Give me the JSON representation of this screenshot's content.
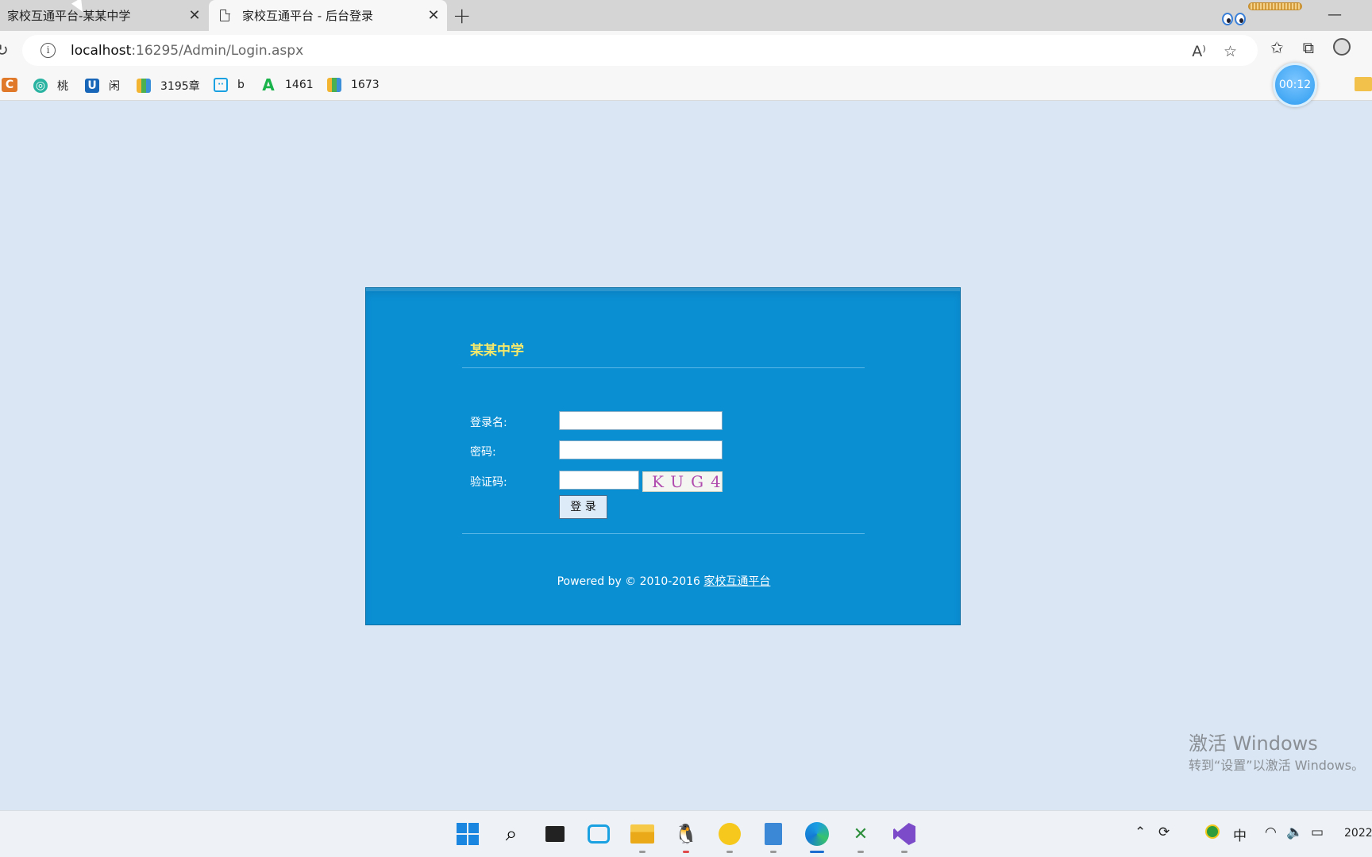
{
  "tabs": [
    {
      "title": "家校互通平台-某某中学",
      "active": false
    },
    {
      "title": "家校互通平台 - 后台登录",
      "active": true
    }
  ],
  "address": {
    "host": "localhost",
    "rest": ":16295/Admin/Login.aspx"
  },
  "bookmarks": [
    {
      "label": "桃",
      "icon": "peach-bookmark-icon"
    },
    {
      "label": "闲",
      "icon": "u-bookmark-icon"
    },
    {
      "label": "3195章",
      "icon": "book-bookmark-icon"
    },
    {
      "label": "b",
      "icon": "bilibili-bookmark-icon"
    },
    {
      "label": "1461",
      "icon": "a-bookmark-icon"
    },
    {
      "label": "1673",
      "icon": "book-bookmark-icon"
    }
  ],
  "timer": "00:12",
  "login": {
    "school_name": "某某中学",
    "username_label": "登录名:",
    "password_label": "密码:",
    "captcha_label": "验证码:",
    "username_value": "",
    "password_value": "",
    "captcha_value": "",
    "captcha_text": "KUG4",
    "submit_label": "登 录",
    "footer_prefix": "Powered by  © 2010-2016 ",
    "footer_link": "家校互通平台"
  },
  "watermark": {
    "title": "激活 Windows",
    "subtitle": "转到“设置”以激活 Windows。"
  },
  "taskbar": {
    "ime": "中",
    "clock": "2022"
  },
  "colors": {
    "page_bg": "#dae6f3",
    "panel_bg": "#0b8fd3",
    "school_name": "#f5e96b",
    "captcha_text": "#b04cae"
  }
}
